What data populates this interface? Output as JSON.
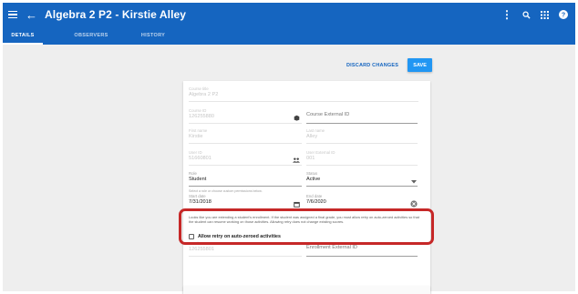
{
  "header": {
    "title": "Algebra 2 P2 - Kirstie Alley",
    "tabs": [
      {
        "label": "DETAILS"
      },
      {
        "label": "OBSERVERS"
      },
      {
        "label": "HISTORY"
      }
    ]
  },
  "actions": {
    "discard_label": "DISCARD CHANGES",
    "save_label": "SAVE"
  },
  "form": {
    "course_title": {
      "label": "Course title",
      "value": "Algebra 2 P2"
    },
    "course_id": {
      "label": "Course ID",
      "value": "126255880"
    },
    "course_external_id": {
      "placeholder": "Course External ID"
    },
    "first_name": {
      "label": "First name",
      "value": "Kirstie"
    },
    "last_name": {
      "label": "Last name",
      "value": "Alley"
    },
    "user_id": {
      "label": "User ID",
      "value": "51660801"
    },
    "user_external_id": {
      "label": "User External ID",
      "value": "001"
    },
    "role": {
      "label": "Role",
      "value": "Student",
      "hint": "Select a role or choose custom permissions below."
    },
    "status": {
      "label": "Status",
      "value": "Active"
    },
    "start_date": {
      "label": "Start date",
      "value": "7/31/2018"
    },
    "end_date": {
      "label": "End date",
      "value": "7/6/2020"
    },
    "enrollment_id": {
      "label": "Enrollment ID",
      "value": "126255801"
    },
    "enrollment_external_id": {
      "placeholder": "Enrollment External ID"
    }
  },
  "notice": {
    "text": "Looks like you are extending a student's enrollment. If the student was assigned a final grade, you must allow retry on auto-zeroed activities so that the student can resume working on those activities. Allowing retry does not change existing scores.",
    "checkbox_label": "Allow retry on auto-zeroed activities"
  },
  "colors": {
    "header_bg": "#1565c0",
    "save_bg": "#2196f3",
    "highlight": "#c62828"
  }
}
